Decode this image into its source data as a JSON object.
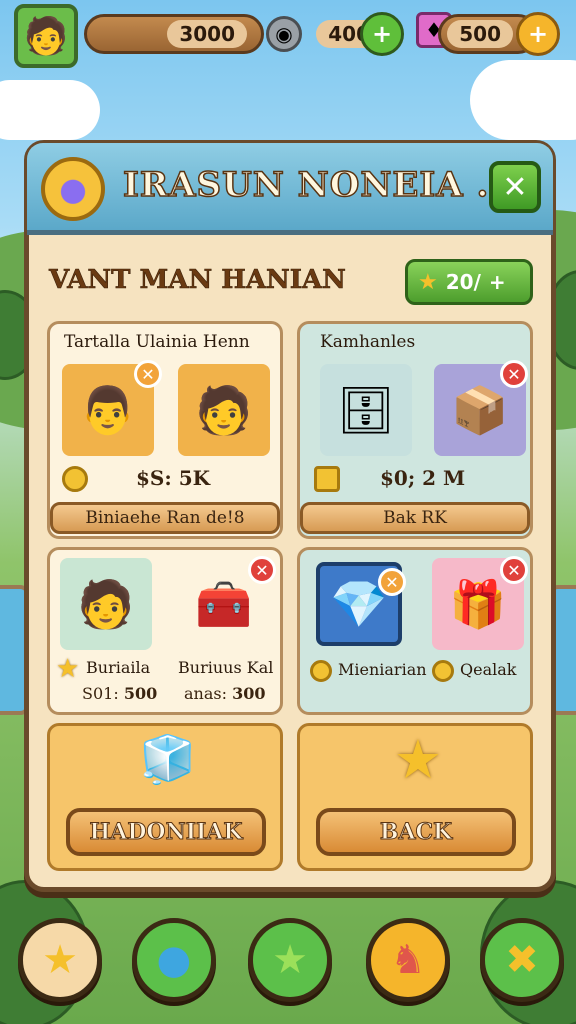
{
  "topbar": {
    "coins": "3000",
    "gems": "400",
    "tickets": "500",
    "add_symbol": "+"
  },
  "panel": {
    "title": "IRASUN NONEIA ...",
    "close_symbol": "✕",
    "subtitle": "VANT MAN HANIAN",
    "score": "20/",
    "score_add": "+"
  },
  "cards": {
    "people": {
      "title": "Tartalla Ulainia Henn",
      "price": "$S: 5K",
      "button": "Biniaehe Ran de!8"
    },
    "machines": {
      "title": "Kamhanles",
      "price": "$0; 2 M",
      "button": "Bak RK"
    },
    "items_left": {
      "item1_label": "Buriaila",
      "item1_cost": "500",
      "item1_cost_prefix": "S01:",
      "item2_label": "Buriuus Kal",
      "item2_cost": "300",
      "item2_cost_prefix": "anas:"
    },
    "items_right": {
      "item1_label": "Mieniarian",
      "item2_label": "Qealak"
    }
  },
  "actions": {
    "left_button": "HADONIIAK",
    "right_button": "BACK"
  },
  "colors": {
    "accent_green": "#4d9e2d",
    "wood": "#6a4a2b",
    "panel_bg": "#f6e3c0",
    "header_blue": "#5ba8c9"
  }
}
